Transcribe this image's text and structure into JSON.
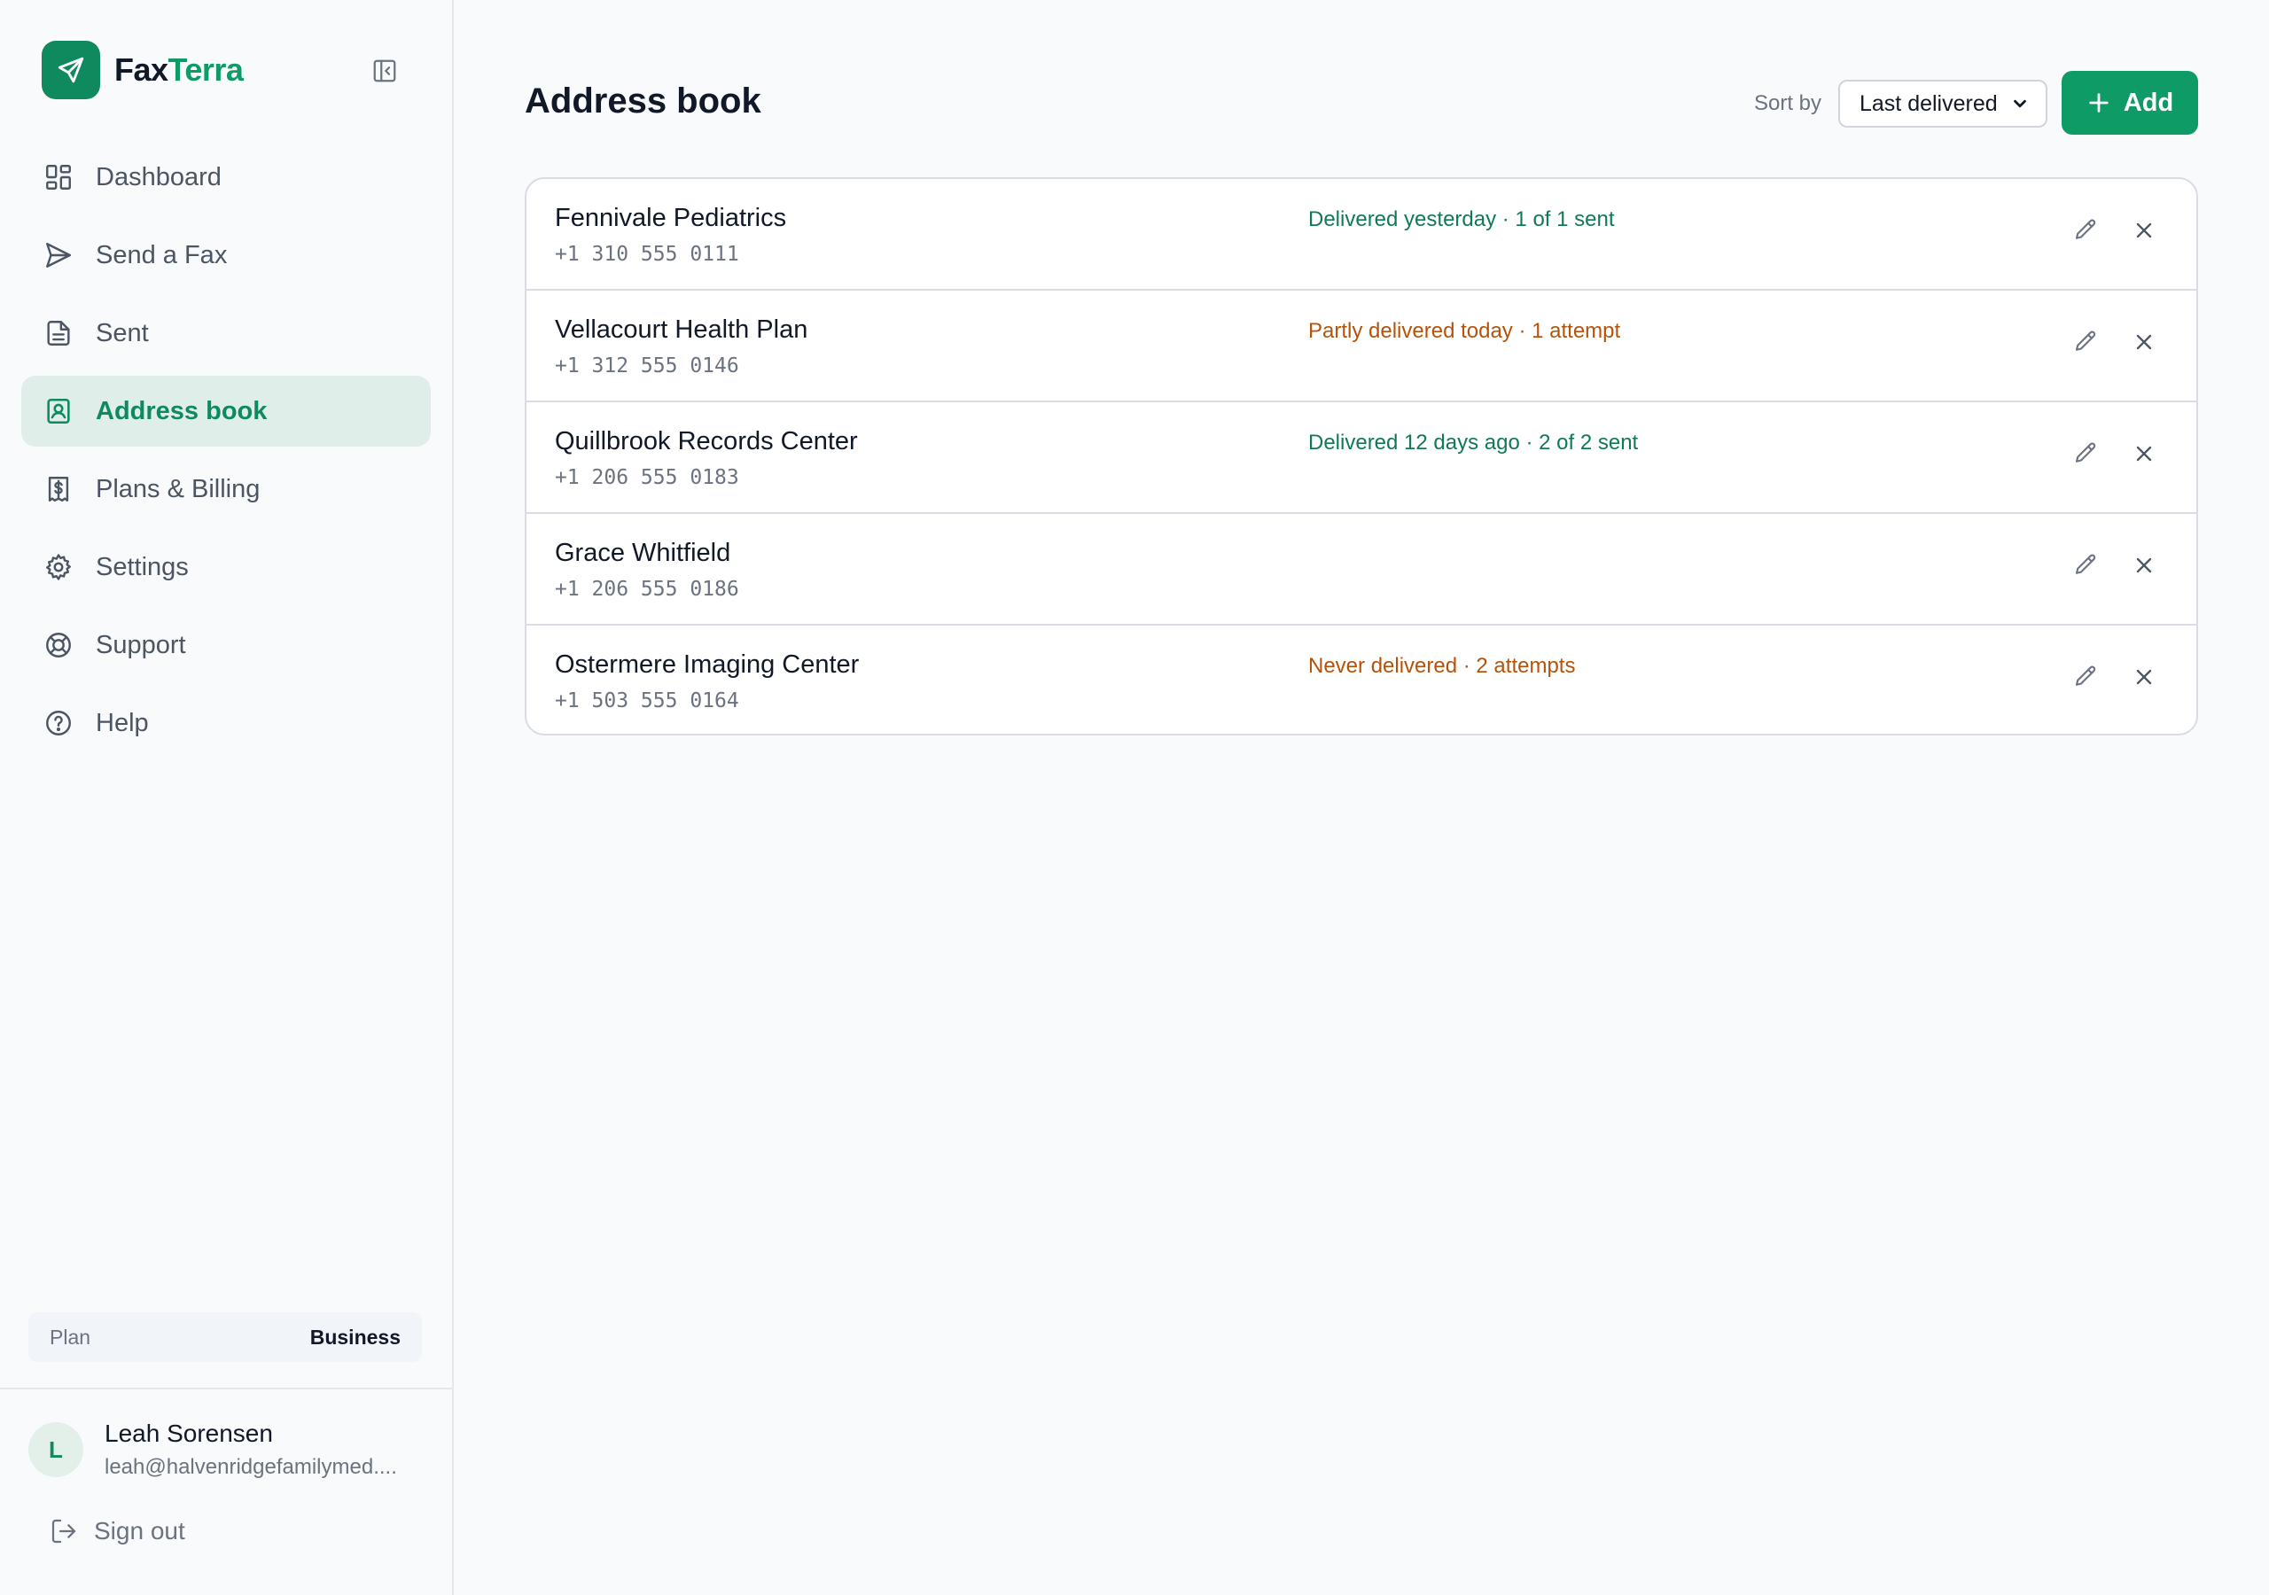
{
  "brand": {
    "part1": "Fax",
    "part2": "Terra",
    "accent": "#0f9b66"
  },
  "nav": {
    "items": [
      {
        "label": "Dashboard",
        "icon": "dashboard-icon"
      },
      {
        "label": "Send a Fax",
        "icon": "send-icon"
      },
      {
        "label": "Sent",
        "icon": "document-icon"
      },
      {
        "label": "Address book",
        "icon": "address-book-icon",
        "active": true
      },
      {
        "label": "Plans & Billing",
        "icon": "billing-icon"
      },
      {
        "label": "Settings",
        "icon": "gear-icon"
      },
      {
        "label": "Support",
        "icon": "lifebuoy-icon"
      },
      {
        "label": "Help",
        "icon": "help-icon"
      }
    ]
  },
  "plan": {
    "label": "Plan",
    "value": "Business"
  },
  "user": {
    "initial": "L",
    "name": "Leah Sorensen",
    "email": "leah@halvenridgefamilymed...."
  },
  "signout": {
    "label": "Sign out"
  },
  "main": {
    "title": "Address book",
    "sort_label": "Sort by",
    "sort_value": "Last delivered",
    "add_label": "Add"
  },
  "contacts": [
    {
      "name": "Fennivale Pediatrics",
      "number": "+1 310 555 0111",
      "status": "Delivered yesterday · 1 of 1 sent",
      "status_color": "green"
    },
    {
      "name": "Vellacourt Health Plan",
      "number": "+1 312 555 0146",
      "status": "Partly delivered today · 1 attempt",
      "status_color": "orange"
    },
    {
      "name": "Quillbrook Records Center",
      "number": "+1 206 555 0183",
      "status": "Delivered 12 days ago · 2 of 2 sent",
      "status_color": "green"
    },
    {
      "name": "Grace Whitfield",
      "number": "+1 206 555 0186",
      "status": "",
      "status_color": ""
    },
    {
      "name": "Ostermere Imaging Center",
      "number": "+1 503 555 0164",
      "status": "Never delivered · 2 attempts",
      "status_color": "orange"
    }
  ]
}
